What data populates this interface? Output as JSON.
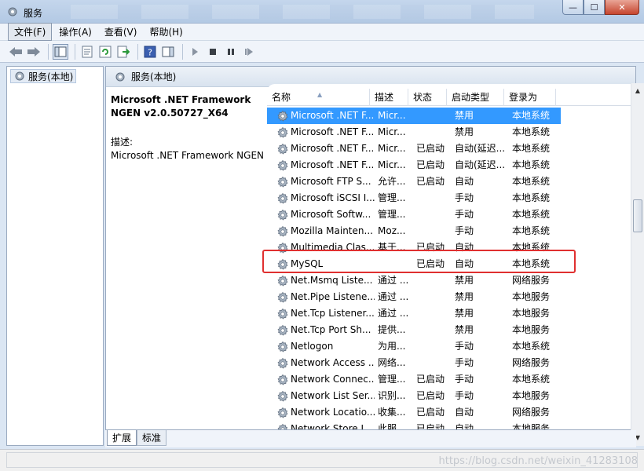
{
  "window": {
    "title": "服务",
    "buttons": {
      "minimize": "—",
      "maximize": "☐",
      "close": "✕"
    }
  },
  "menu": [
    {
      "label": "文件(F)"
    },
    {
      "label": "操作(A)"
    },
    {
      "label": "查看(V)"
    },
    {
      "label": "帮助(H)"
    }
  ],
  "tree": {
    "root": "服务(本地)"
  },
  "main": {
    "header": "服务(本地)",
    "selected_service": {
      "title_line1": "Microsoft .NET Framework",
      "title_line2": "NGEN v2.0.50727_X64",
      "desc_label": "描述:",
      "desc_text": "Microsoft .NET Framework NGEN"
    },
    "columns": [
      "名称",
      "描述",
      "状态",
      "启动类型",
      "登录为"
    ],
    "rows": [
      {
        "name": "Microsoft .NET F...",
        "desc": "Micr...",
        "status": "",
        "start": "禁用",
        "logon": "本地系统"
      },
      {
        "name": "Microsoft .NET F...",
        "desc": "Micr...",
        "status": "",
        "start": "禁用",
        "logon": "本地系统"
      },
      {
        "name": "Microsoft .NET F...",
        "desc": "Micr...",
        "status": "已启动",
        "start": "自动(延迟...",
        "logon": "本地系统"
      },
      {
        "name": "Microsoft .NET F...",
        "desc": "Micr...",
        "status": "已启动",
        "start": "自动(延迟...",
        "logon": "本地系统"
      },
      {
        "name": "Microsoft FTP S...",
        "desc": "允许...",
        "status": "已启动",
        "start": "自动",
        "logon": "本地系统"
      },
      {
        "name": "Microsoft iSCSI I...",
        "desc": "管理...",
        "status": "",
        "start": "手动",
        "logon": "本地系统"
      },
      {
        "name": "Microsoft Softw...",
        "desc": "管理...",
        "status": "",
        "start": "手动",
        "logon": "本地系统"
      },
      {
        "name": "Mozilla Mainten...",
        "desc": "Moz...",
        "status": "",
        "start": "手动",
        "logon": "本地系统"
      },
      {
        "name": "Multimedia Clas...",
        "desc": "基于...",
        "status": "已启动",
        "start": "自动",
        "logon": "本地系统"
      },
      {
        "name": "MySQL",
        "desc": "",
        "status": "已启动",
        "start": "自动",
        "logon": "本地系统"
      },
      {
        "name": "Net.Msmq Liste...",
        "desc": "通过 ...",
        "status": "",
        "start": "禁用",
        "logon": "网络服务"
      },
      {
        "name": "Net.Pipe Listene...",
        "desc": "通过 ...",
        "status": "",
        "start": "禁用",
        "logon": "本地服务"
      },
      {
        "name": "Net.Tcp Listener...",
        "desc": "通过 ...",
        "status": "",
        "start": "禁用",
        "logon": "本地服务"
      },
      {
        "name": "Net.Tcp Port Sh...",
        "desc": "提供...",
        "status": "",
        "start": "禁用",
        "logon": "本地服务"
      },
      {
        "name": "Netlogon",
        "desc": "为用...",
        "status": "",
        "start": "手动",
        "logon": "本地系统"
      },
      {
        "name": "Network Access ...",
        "desc": "网络...",
        "status": "",
        "start": "手动",
        "logon": "网络服务"
      },
      {
        "name": "Network Connec...",
        "desc": "管理...",
        "status": "已启动",
        "start": "手动",
        "logon": "本地系统"
      },
      {
        "name": "Network List Ser...",
        "desc": "识别...",
        "status": "已启动",
        "start": "手动",
        "logon": "本地服务"
      },
      {
        "name": "Network Locatio...",
        "desc": "收集...",
        "status": "已启动",
        "start": "自动",
        "logon": "网络服务"
      },
      {
        "name": "Network Store I...",
        "desc": "此服...",
        "status": "已启动",
        "start": "自动",
        "logon": "本地服务"
      }
    ]
  },
  "tabs": [
    {
      "label": "扩展"
    },
    {
      "label": "标准"
    }
  ],
  "watermark": "https://blog.csdn.net/weixin_41283108"
}
